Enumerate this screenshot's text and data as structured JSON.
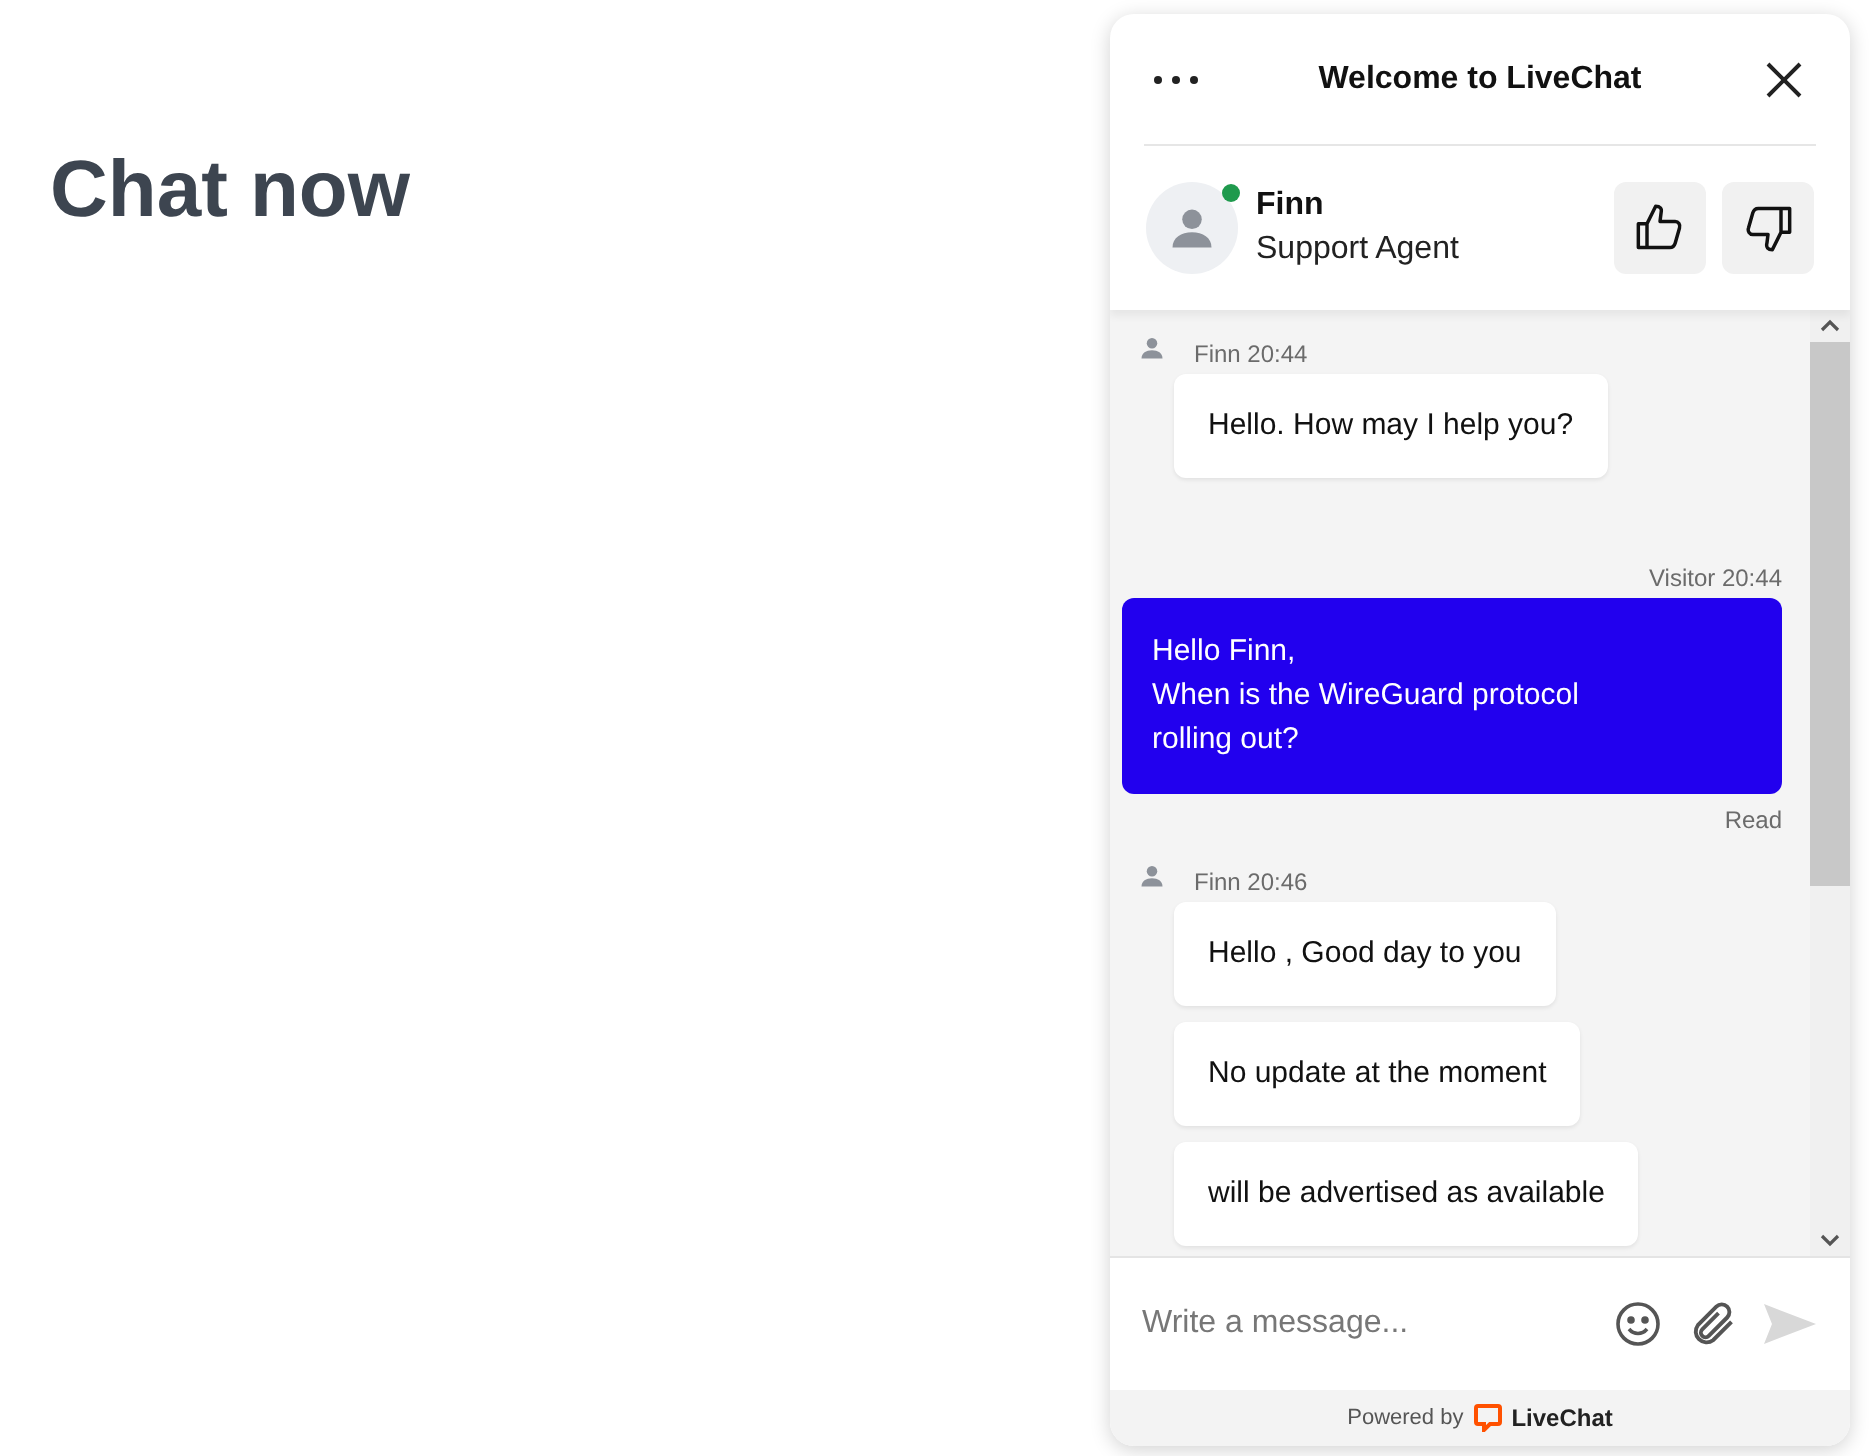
{
  "page": {
    "heading": "Chat now"
  },
  "widget": {
    "title": "Welcome to LiveChat",
    "agent": {
      "name": "Finn",
      "role": "Support Agent",
      "online": true
    },
    "groups": [
      {
        "kind": "agent",
        "meta": "Finn 20:44",
        "messages": [
          "Hello. How may I help you?"
        ]
      },
      {
        "kind": "visitor",
        "meta": "Visitor 20:44",
        "messages": [
          "Hello Finn,\nWhen is the WireGuard protocol\nrolling out?"
        ],
        "status": "Read"
      },
      {
        "kind": "agent",
        "meta": "Finn 20:46",
        "messages": [
          "Hello , Good day to you",
          "No update at the moment",
          "will be advertised as available"
        ]
      }
    ],
    "composer": {
      "placeholder": "Write a message..."
    },
    "footer": {
      "prefix": "Powered by",
      "brand": "LiveChat"
    }
  }
}
